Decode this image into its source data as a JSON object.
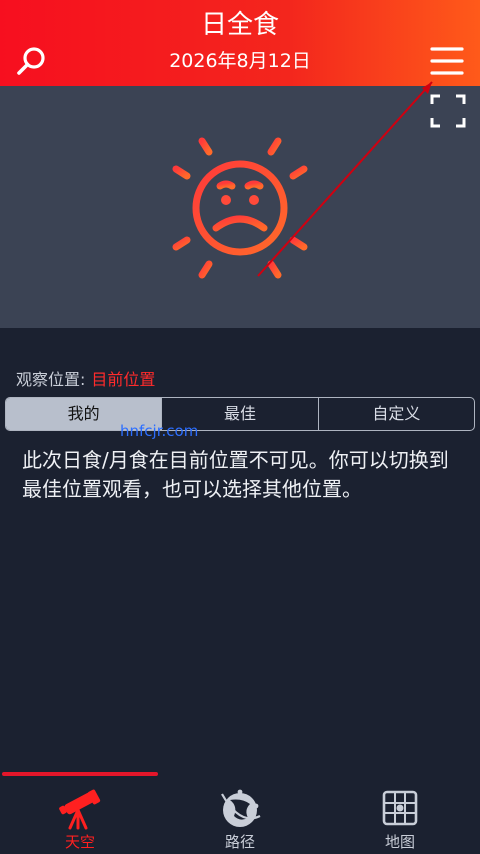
{
  "header": {
    "title": "日全食",
    "date": "2026年8月12日"
  },
  "icons": {
    "search": "search-icon",
    "menu": "hamburger-menu-icon",
    "fullscreen": "fullscreen-icon",
    "sun": "sad-sun-icon"
  },
  "observation": {
    "label": "观察位置:",
    "value": "目前位置"
  },
  "segments": [
    {
      "label": "我的",
      "active": true
    },
    {
      "label": "最佳",
      "active": false
    },
    {
      "label": "自定义",
      "active": false
    }
  ],
  "watermark": "hnfcjr.com",
  "message": "此次日食/月食在目前位置不可见。你可以切换到最佳位置观看，也可以选择其他位置。",
  "bottom_nav": [
    {
      "label": "天空",
      "icon": "telescope-icon",
      "active": true
    },
    {
      "label": "路径",
      "icon": "globe-path-icon",
      "active": false
    },
    {
      "label": "地图",
      "icon": "map-grid-icon",
      "active": false
    }
  ],
  "colors": {
    "accent": "#f70f1f",
    "sun": "#ff4a3a",
    "sky_background": "#3b4354",
    "page_background": "#1b2130"
  }
}
